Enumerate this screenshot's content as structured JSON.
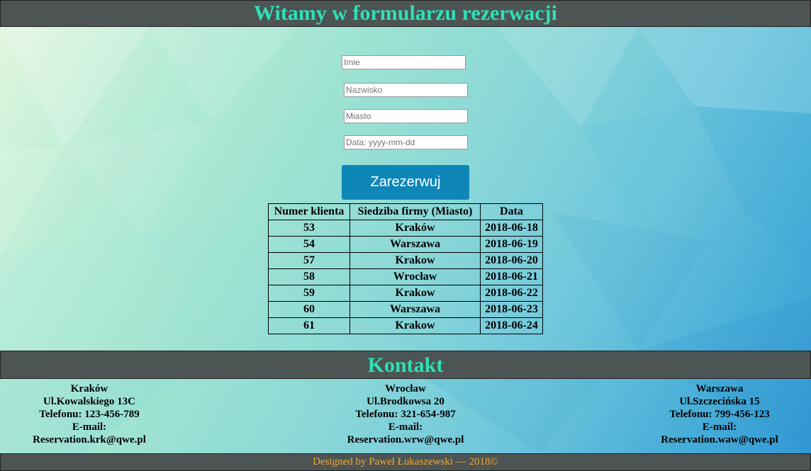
{
  "header": {
    "title": "Witamy w formularzu rezerwacji"
  },
  "form": {
    "imie_placeholder": "Imie",
    "nazwisko_placeholder": "Nazwisko",
    "miasto_placeholder": "Miasto",
    "data_placeholder": "Data: yyyy-mm-dd",
    "submit_label": "Zarezerwuj"
  },
  "table": {
    "headers": [
      "Numer klienta",
      "Siedziba firmy (Miasto)",
      "Data"
    ],
    "rows": [
      [
        "53",
        "Kraków",
        "2018-06-18"
      ],
      [
        "54",
        "Warszawa",
        "2018-06-19"
      ],
      [
        "57",
        "Krakow",
        "2018-06-20"
      ],
      [
        "58",
        "Wrocław",
        "2018-06-21"
      ],
      [
        "59",
        "Krakow",
        "2018-06-22"
      ],
      [
        "60",
        "Warszawa",
        "2018-06-23"
      ],
      [
        "61",
        "Krakow",
        "2018-06-24"
      ]
    ]
  },
  "kontakt": {
    "title": "Kontakt",
    "offices": [
      {
        "city": "Kraków",
        "address": "Ul.Kowalskiego 13C",
        "phone": "Telefonu: 123-456-789",
        "email_label": "E-mail:",
        "email": "Reservation.krk@qwe.pl"
      },
      {
        "city": "Wrocław",
        "address": "Ul.Brodkowsa 20",
        "phone": "Telefonu: 321-654-987",
        "email_label": "E-mail:",
        "email": "Reservation.wrw@qwe.pl"
      },
      {
        "city": "Warszawa",
        "address": "Ul.Szczecińska 15",
        "phone": "Telefonu: 799-456-123",
        "email_label": "E-mail:",
        "email": "Reservation.waw@qwe.pl"
      }
    ]
  },
  "footer": {
    "text": "Designed by Paweł Łukaszewski — 2018©"
  },
  "colors": {
    "bar_background": "#4d5454",
    "heading_text": "#2fe0b6",
    "button": "#0e87b8",
    "footer_text": "#f0a830"
  }
}
